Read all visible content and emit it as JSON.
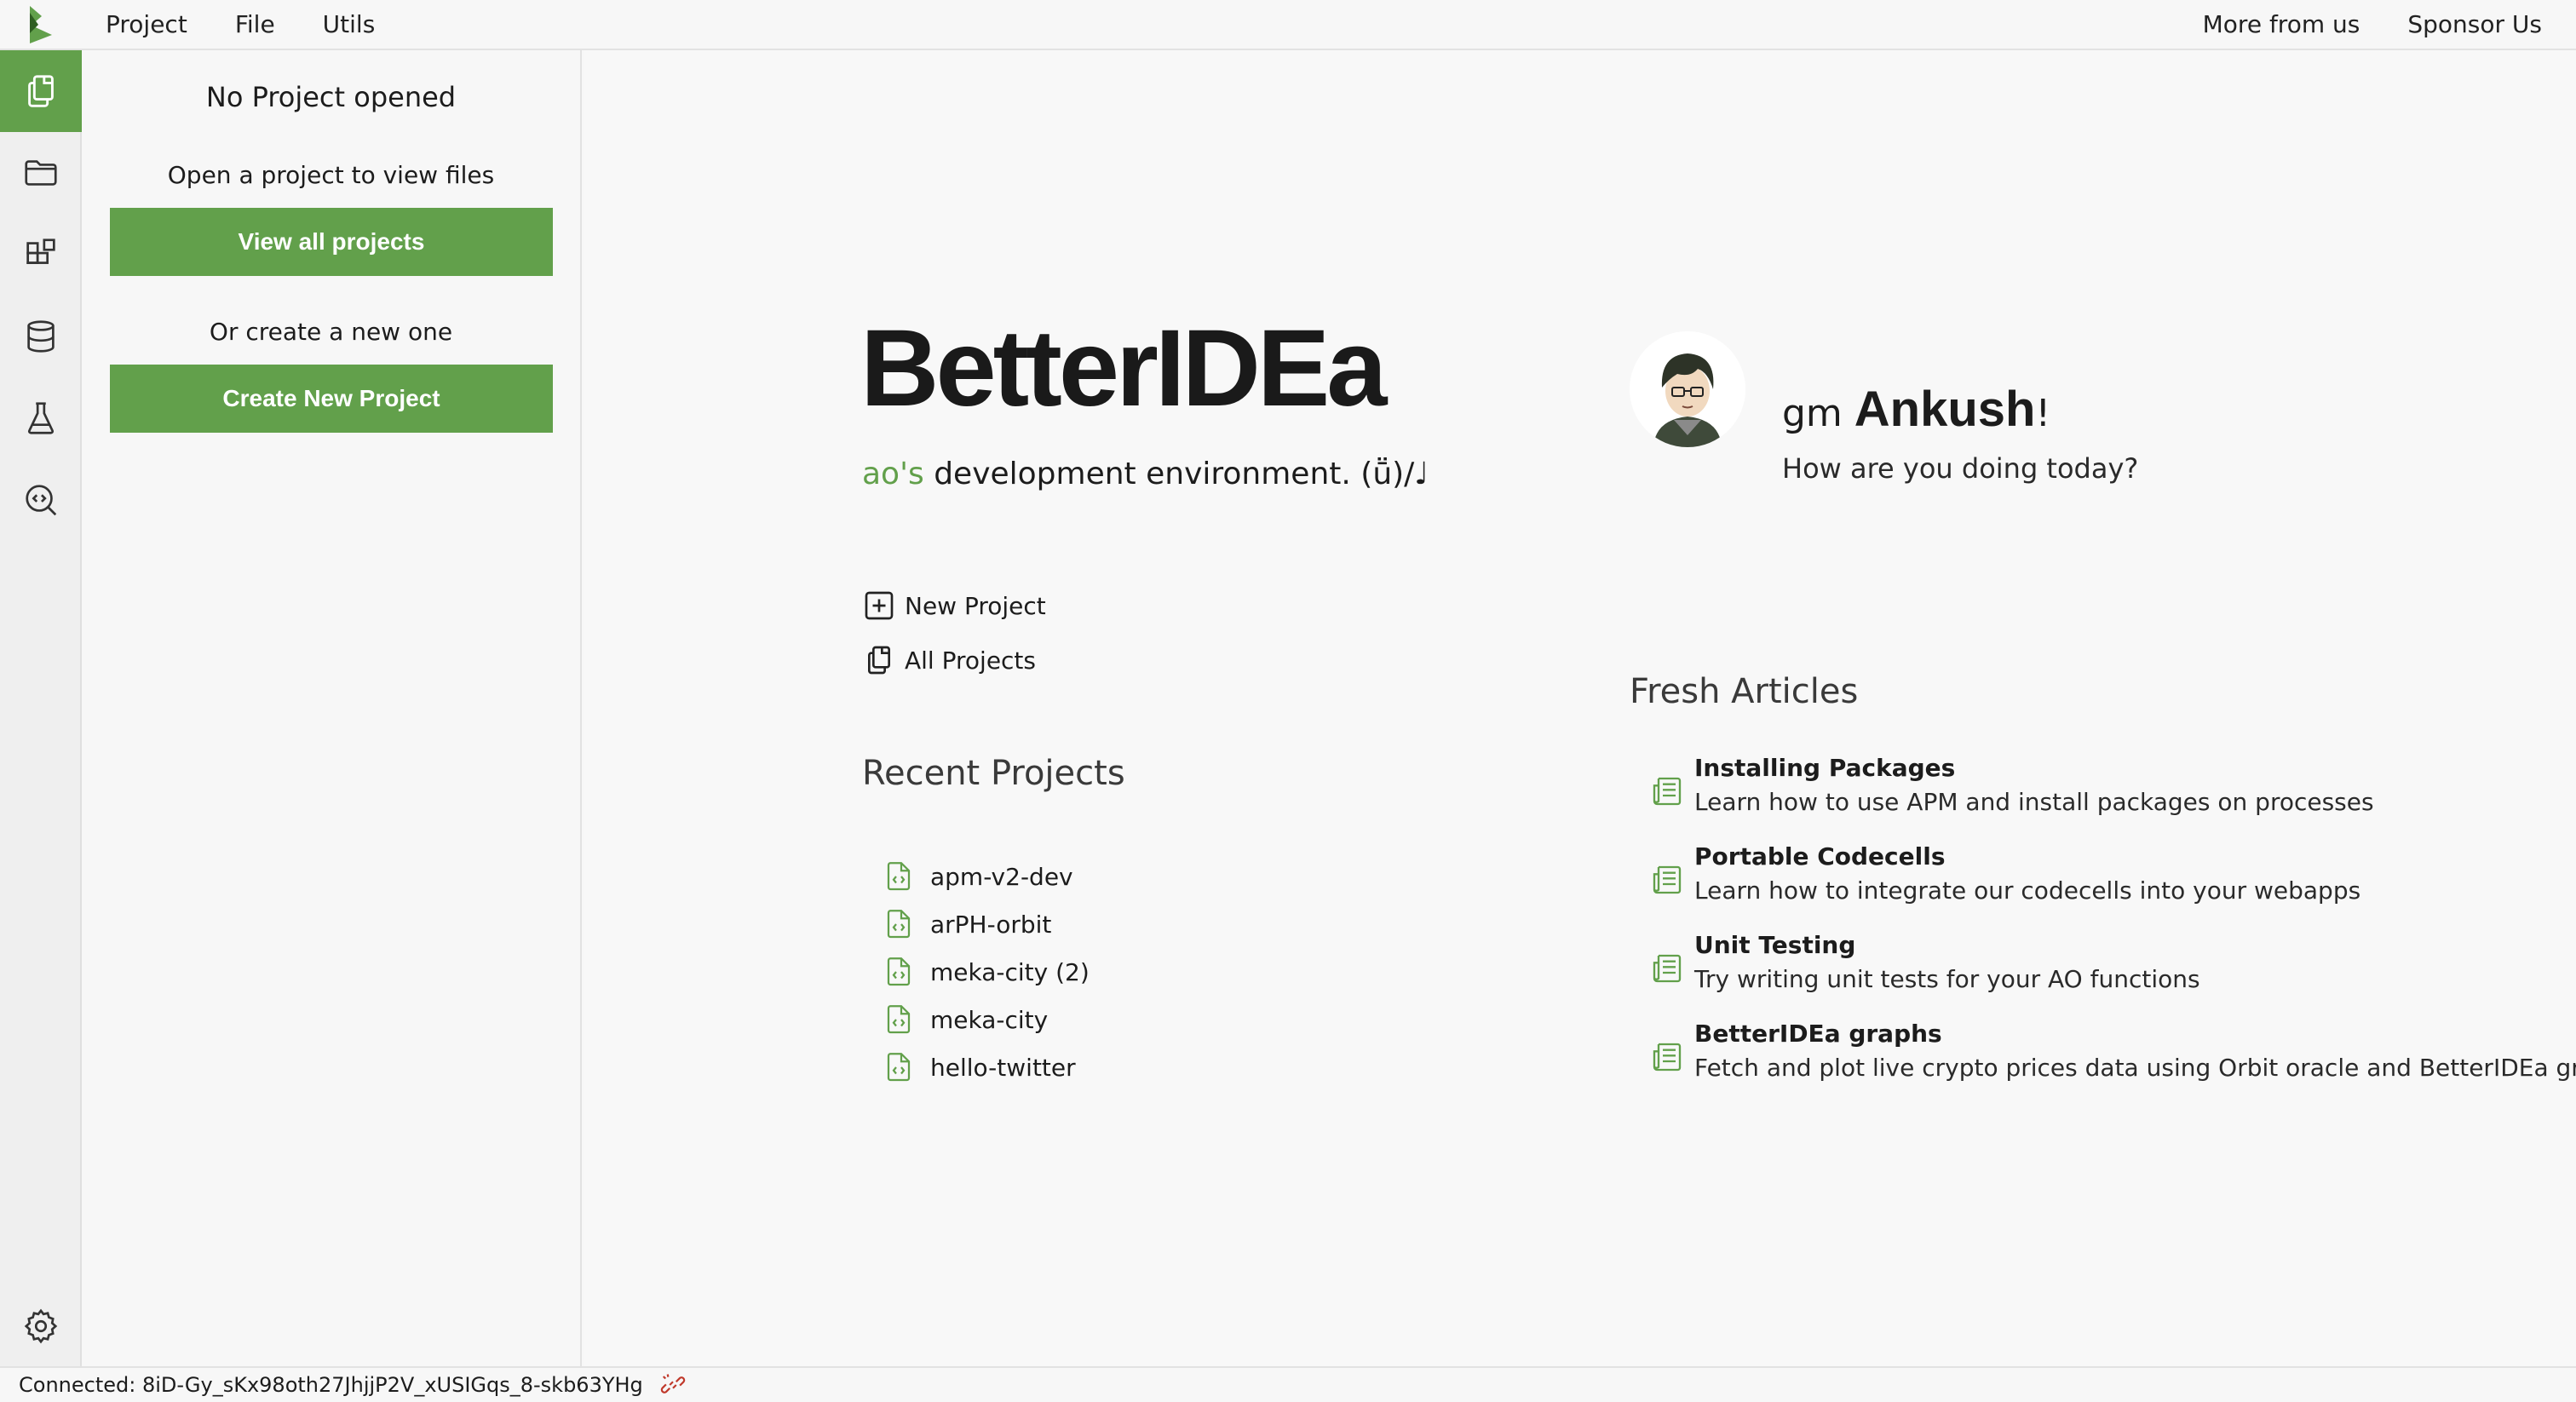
{
  "menubar": {
    "menus": [
      "Project",
      "File",
      "Utils"
    ],
    "right_links": [
      "More from us",
      "Sponsor Us"
    ]
  },
  "activitybar": {
    "icons": [
      "files-icon",
      "folder-icon",
      "packages-icon",
      "database-icon",
      "flask-icon",
      "code-search-icon"
    ],
    "settings_icon": "gear-icon"
  },
  "sidepanel": {
    "title": "No Project opened",
    "open_text": "Open a project to view files",
    "view_all_label": "View all projects",
    "or_text": "Or create a new one",
    "create_label": "Create New Project"
  },
  "hero": {
    "brand": "BetterIDEa",
    "tagline_highlight": "ao's",
    "tagline_rest": " development environment. (ṻ)/♩"
  },
  "quick_links": {
    "new_project": "New Project",
    "all_projects": "All Projects"
  },
  "recent": {
    "title": "Recent Projects",
    "items": [
      "apm-v2-dev",
      "arPH-orbit",
      "meka-city (2)",
      "meka-city",
      "hello-twitter"
    ]
  },
  "profile": {
    "greeting_prefix": "gm ",
    "name": "Ankush",
    "greeting_suffix": "!",
    "subtitle": "How are you doing today?"
  },
  "articles": {
    "title": "Fresh Articles",
    "items": [
      {
        "title": "Installing Packages",
        "desc": "Learn how to use APM and install packages on processes"
      },
      {
        "title": "Portable Codecells",
        "desc": "Learn how to integrate our codecells into your webapps"
      },
      {
        "title": "Unit Testing",
        "desc": "Try writing unit tests for your AO functions"
      },
      {
        "title": "BetterIDEa graphs",
        "desc": "Fetch and plot live crypto prices data using Orbit oracle and BetterIDEa gr"
      }
    ]
  },
  "statusbar": {
    "connection": "Connected: 8iD-Gy_sKx98oth27JhjjP2V_xUSIGqs_8-skb63YHg"
  },
  "colors": {
    "accent": "#62a04b",
    "background": "#f7f7f7",
    "text": "#1c1c1c"
  }
}
